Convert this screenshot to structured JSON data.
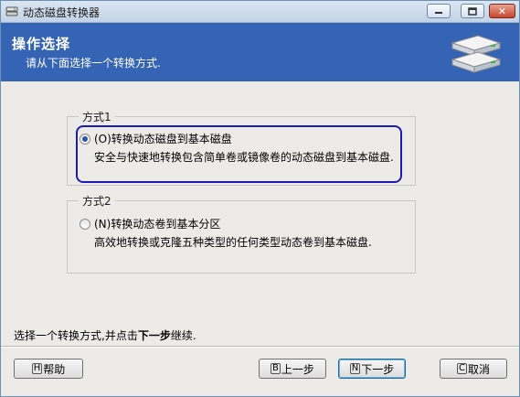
{
  "window": {
    "title": "动态磁盘转换器"
  },
  "header": {
    "title": "操作选择",
    "subtitle": "请从下面选择一个转换方式."
  },
  "method1": {
    "group_label": "方式1",
    "option_label": "(O)转换动态磁盘到基本磁盘",
    "description": "安全与快速地转换包含简单卷或镜像卷的动态磁盘到基本磁盘.",
    "selected": true
  },
  "method2": {
    "group_label": "方式2",
    "option_label": "(N)转换动态卷到基本分区",
    "description": "高效地转换或克隆五种类型的任何类型动态卷到基本磁盘.",
    "selected": false
  },
  "footer": {
    "instruction_prefix": "选择一个转换方式,并点击",
    "instruction_bold": "下一步",
    "instruction_suffix": "继续."
  },
  "buttons": {
    "help": {
      "mnemonic": "H",
      "label": "帮助"
    },
    "back": {
      "mnemonic": "B",
      "label": "上一步"
    },
    "next": {
      "mnemonic": "N",
      "label": "下一步"
    },
    "cancel": {
      "mnemonic": "C",
      "label": "取消"
    }
  },
  "colors": {
    "header_bg": "#3564b5",
    "focus_ring": "#1e1bb4",
    "window_bg": "#ecebe8"
  }
}
